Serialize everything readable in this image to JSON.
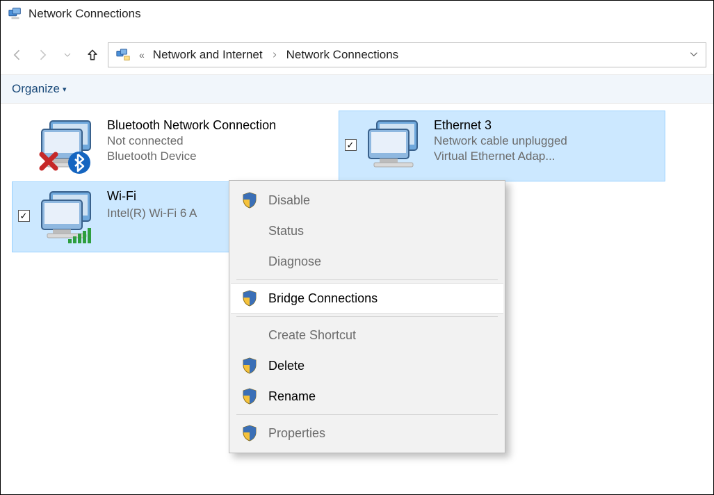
{
  "window": {
    "title": "Network Connections"
  },
  "breadcrumb": {
    "prefix": "«",
    "parent": "Network and Internet",
    "current": "Network Connections"
  },
  "toolbar": {
    "organize": "Organize"
  },
  "connections": [
    {
      "name": "Bluetooth Network Connection",
      "status": "Not connected",
      "device": "Bluetooth Device",
      "selected": false,
      "checkbox": false,
      "overlay": "bluetooth-fail"
    },
    {
      "name": "Ethernet 3",
      "status": "Network cable unplugged",
      "device": "Virtual Ethernet Adap...",
      "selected": true,
      "checkbox": true,
      "overlay": "none"
    },
    {
      "name": "Wi-Fi",
      "status": "",
      "device": "Intel(R) Wi-Fi 6 A",
      "selected": true,
      "checkbox": true,
      "overlay": "wifi"
    }
  ],
  "context_menu": {
    "items": [
      {
        "label": "Disable",
        "icon": "shield",
        "enabled": false
      },
      {
        "label": "Status",
        "icon": "",
        "enabled": false
      },
      {
        "label": "Diagnose",
        "icon": "",
        "enabled": false
      },
      {
        "sep": true
      },
      {
        "label": "Bridge Connections",
        "icon": "shield",
        "enabled": true,
        "highlight": true
      },
      {
        "sep": true
      },
      {
        "label": "Create Shortcut",
        "icon": "",
        "enabled": false
      },
      {
        "label": "Delete",
        "icon": "shield",
        "enabled": true
      },
      {
        "label": "Rename",
        "icon": "shield",
        "enabled": true
      },
      {
        "sep": true
      },
      {
        "label": "Properties",
        "icon": "shield",
        "enabled": false
      }
    ]
  }
}
